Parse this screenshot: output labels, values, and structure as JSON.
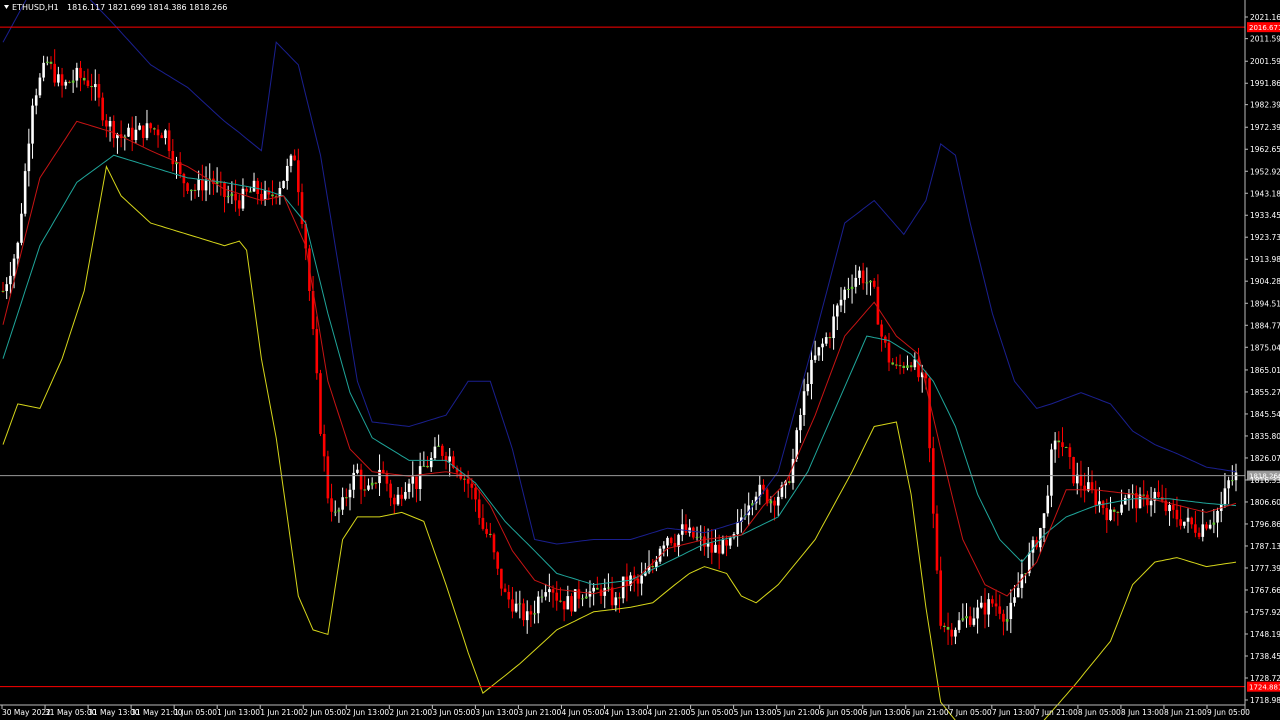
{
  "window": {
    "symbol_label": "ETHUSD,H1",
    "ohlc_label": "1816.117 1821.699 1814.386 1818.266"
  },
  "colors": {
    "background": "#000000",
    "bull_candle": "#ffffff",
    "bear_candle": "#ff0000",
    "doji_candle": "#66cc33",
    "bollinger_upper": "#1a1f8f",
    "bollinger_lower": "#d6d61a",
    "ma_fast": "#c81414",
    "ma_slow": "#1fa59a",
    "level_line": "#ff0000",
    "current_price_line": "#9a9a9a",
    "axis": "#bdbdbd"
  },
  "chart_data": {
    "type": "candlestick",
    "timeframe": "H1",
    "y_ticks": [
      "2021.166",
      "2011.595",
      "2001.595",
      "1991.860",
      "1982.390",
      "1972.390",
      "1962.655",
      "1952.920",
      "1943.185",
      "1933.455",
      "1923.735",
      "1913.988",
      "1904.285",
      "1894.510",
      "1884.775",
      "1875.040",
      "1865.010",
      "1855.275",
      "1845.540",
      "1835.805",
      "1826.070",
      "1816.335",
      "1806.600",
      "1796.865",
      "1787.130",
      "1777.395",
      "1767.660",
      "1757.925",
      "1748.190",
      "1738.455",
      "1728.720",
      "1718.985"
    ],
    "y_range": [
      1718.985,
      2021.166
    ],
    "x_ticks": [
      "30 May 2022",
      "31 May 05:00",
      "31 May 13:00",
      "31 May 21:00",
      "1 Jun 05:00",
      "1 Jun 13:00",
      "1 Jun 21:00",
      "2 Jun 05:00",
      "2 Jun 13:00",
      "2 Jun 21:00",
      "3 Jun 05:00",
      "3 Jun 13:00",
      "3 Jun 21:00",
      "4 Jun 05:00",
      "4 Jun 13:00",
      "4 Jun 21:00",
      "5 Jun 05:00",
      "5 Jun 13:00",
      "5 Jun 21:00",
      "6 Jun 05:00",
      "6 Jun 13:00",
      "6 Jun 21:00",
      "7 Jun 05:00",
      "7 Jun 13:00",
      "7 Jun 21:00",
      "8 Jun 05:00",
      "8 Jun 13:00",
      "8 Jun 21:00",
      "9 Jun 05:00"
    ],
    "price_markers": [
      {
        "label": "2016.671",
        "value": 2016.671,
        "color": "#ff0000"
      },
      {
        "label": "1818.266",
        "value": 1818.266,
        "color": "#9a9a9a"
      },
      {
        "label": "1724.881",
        "value": 1724.881,
        "color": "#ff0000"
      }
    ],
    "price_path": [
      [
        0,
        1900
      ],
      [
        4,
        1920
      ],
      [
        8,
        1985
      ],
      [
        12,
        2001
      ],
      [
        16,
        1990
      ],
      [
        20,
        1995
      ],
      [
        24,
        1992
      ],
      [
        28,
        1975
      ],
      [
        32,
        1968
      ],
      [
        36,
        1970
      ],
      [
        40,
        1972
      ],
      [
        44,
        1970
      ],
      [
        48,
        1950
      ],
      [
        52,
        1945
      ],
      [
        56,
        1950
      ],
      [
        60,
        1942
      ],
      [
        64,
        1940
      ],
      [
        68,
        1945
      ],
      [
        72,
        1940
      ],
      [
        76,
        1950
      ],
      [
        79,
        1960
      ],
      [
        82,
        1920
      ],
      [
        84,
        1880
      ],
      [
        86,
        1840
      ],
      [
        88,
        1810
      ],
      [
        90,
        1800
      ],
      [
        92,
        1805
      ],
      [
        94,
        1815
      ],
      [
        96,
        1820
      ],
      [
        98,
        1810
      ],
      [
        100,
        1812
      ],
      [
        102,
        1822
      ],
      [
        104,
        1815
      ],
      [
        106,
        1805
      ],
      [
        108,
        1812
      ],
      [
        110,
        1818
      ],
      [
        112,
        1815
      ],
      [
        114,
        1822
      ],
      [
        116,
        1825
      ],
      [
        118,
        1830
      ],
      [
        120,
        1828
      ],
      [
        122,
        1825
      ],
      [
        124,
        1820
      ],
      [
        126,
        1815
      ],
      [
        128,
        1808
      ],
      [
        130,
        1795
      ],
      [
        132,
        1790
      ],
      [
        134,
        1775
      ],
      [
        136,
        1765
      ],
      [
        138,
        1762
      ],
      [
        140,
        1758
      ],
      [
        142,
        1755
      ],
      [
        144,
        1760
      ],
      [
        146,
        1768
      ],
      [
        148,
        1772
      ],
      [
        150,
        1765
      ],
      [
        152,
        1762
      ],
      [
        154,
        1762
      ],
      [
        156,
        1766
      ],
      [
        158,
        1768
      ],
      [
        160,
        1765
      ],
      [
        162,
        1768
      ],
      [
        164,
        1765
      ],
      [
        166,
        1762
      ],
      [
        168,
        1770
      ],
      [
        170,
        1772
      ],
      [
        172,
        1770
      ],
      [
        174,
        1774
      ],
      [
        176,
        1778
      ],
      [
        178,
        1788
      ],
      [
        180,
        1792
      ],
      [
        182,
        1790
      ],
      [
        184,
        1794
      ],
      [
        186,
        1792
      ],
      [
        188,
        1790
      ],
      [
        190,
        1788
      ],
      [
        192,
        1785
      ],
      [
        194,
        1787
      ],
      [
        196,
        1785
      ],
      [
        198,
        1790
      ],
      [
        200,
        1800
      ],
      [
        202,
        1808
      ],
      [
        204,
        1812
      ],
      [
        206,
        1810
      ],
      [
        208,
        1808
      ],
      [
        210,
        1810
      ],
      [
        212,
        1812
      ],
      [
        214,
        1825
      ],
      [
        216,
        1845
      ],
      [
        218,
        1862
      ],
      [
        220,
        1870
      ],
      [
        222,
        1876
      ],
      [
        224,
        1882
      ],
      [
        226,
        1892
      ],
      [
        228,
        1900
      ],
      [
        230,
        1905
      ],
      [
        232,
        1908
      ],
      [
        234,
        1904
      ],
      [
        236,
        1898
      ],
      [
        238,
        1880
      ],
      [
        240,
        1870
      ],
      [
        242,
        1865
      ],
      [
        244,
        1868
      ],
      [
        246,
        1870
      ],
      [
        248,
        1862
      ],
      [
        250,
        1858
      ],
      [
        252,
        1800
      ],
      [
        254,
        1755
      ],
      [
        256,
        1750
      ],
      [
        258,
        1752
      ],
      [
        260,
        1754
      ],
      [
        262,
        1756
      ],
      [
        264,
        1758
      ],
      [
        266,
        1760
      ],
      [
        268,
        1762
      ],
      [
        270,
        1760
      ],
      [
        272,
        1755
      ],
      [
        274,
        1762
      ],
      [
        276,
        1775
      ],
      [
        278,
        1782
      ],
      [
        280,
        1790
      ],
      [
        282,
        1800
      ],
      [
        284,
        1826
      ],
      [
        286,
        1835
      ],
      [
        288,
        1828
      ],
      [
        290,
        1818
      ],
      [
        292,
        1815
      ],
      [
        294,
        1812
      ],
      [
        296,
        1808
      ],
      [
        298,
        1805
      ],
      [
        300,
        1800
      ],
      [
        302,
        1805
      ],
      [
        304,
        1810
      ],
      [
        306,
        1808
      ],
      [
        308,
        1806
      ],
      [
        310,
        1808
      ],
      [
        312,
        1810
      ],
      [
        314,
        1805
      ],
      [
        316,
        1802
      ],
      [
        318,
        1800
      ],
      [
        320,
        1798
      ],
      [
        322,
        1796
      ],
      [
        324,
        1795
      ],
      [
        326,
        1798
      ],
      [
        328,
        1800
      ],
      [
        330,
        1805
      ],
      [
        332,
        1815
      ],
      [
        334,
        1818
      ]
    ],
    "bollinger_upper": [
      [
        0,
        2010
      ],
      [
        10,
        2040
      ],
      [
        20,
        2035
      ],
      [
        30,
        2018
      ],
      [
        40,
        2000
      ],
      [
        50,
        1990
      ],
      [
        60,
        1975
      ],
      [
        64,
        1970
      ],
      [
        70,
        1962
      ],
      [
        74,
        2010
      ],
      [
        80,
        2000
      ],
      [
        86,
        1960
      ],
      [
        92,
        1900
      ],
      [
        96,
        1860
      ],
      [
        100,
        1842
      ],
      [
        110,
        1840
      ],
      [
        120,
        1845
      ],
      [
        126,
        1860
      ],
      [
        132,
        1860
      ],
      [
        138,
        1830
      ],
      [
        144,
        1790
      ],
      [
        150,
        1788
      ],
      [
        160,
        1790
      ],
      [
        170,
        1790
      ],
      [
        180,
        1795
      ],
      [
        190,
        1793
      ],
      [
        200,
        1798
      ],
      [
        210,
        1820
      ],
      [
        220,
        1880
      ],
      [
        228,
        1930
      ],
      [
        236,
        1940
      ],
      [
        244,
        1925
      ],
      [
        250,
        1940
      ],
      [
        254,
        1965
      ],
      [
        258,
        1960
      ],
      [
        262,
        1930
      ],
      [
        268,
        1890
      ],
      [
        274,
        1860
      ],
      [
        280,
        1848
      ],
      [
        284,
        1850
      ],
      [
        292,
        1855
      ],
      [
        300,
        1850
      ],
      [
        306,
        1838
      ],
      [
        312,
        1832
      ],
      [
        318,
        1828
      ],
      [
        326,
        1822
      ],
      [
        334,
        1820
      ]
    ],
    "bollinger_lower": [
      [
        0,
        1832
      ],
      [
        4,
        1850
      ],
      [
        10,
        1848
      ],
      [
        16,
        1870
      ],
      [
        22,
        1900
      ],
      [
        28,
        1955
      ],
      [
        32,
        1942
      ],
      [
        40,
        1930
      ],
      [
        50,
        1925
      ],
      [
        60,
        1920
      ],
      [
        64,
        1922
      ],
      [
        66,
        1918
      ],
      [
        70,
        1870
      ],
      [
        74,
        1835
      ],
      [
        80,
        1765
      ],
      [
        84,
        1750
      ],
      [
        88,
        1748
      ],
      [
        92,
        1790
      ],
      [
        96,
        1800
      ],
      [
        102,
        1800
      ],
      [
        108,
        1802
      ],
      [
        114,
        1798
      ],
      [
        120,
        1770
      ],
      [
        126,
        1740
      ],
      [
        130,
        1722
      ],
      [
        140,
        1735
      ],
      [
        150,
        1750
      ],
      [
        160,
        1758
      ],
      [
        170,
        1760
      ],
      [
        176,
        1762
      ],
      [
        182,
        1770
      ],
      [
        186,
        1775
      ],
      [
        190,
        1778
      ],
      [
        196,
        1775
      ],
      [
        200,
        1765
      ],
      [
        204,
        1762
      ],
      [
        210,
        1770
      ],
      [
        220,
        1790
      ],
      [
        230,
        1820
      ],
      [
        236,
        1840
      ],
      [
        242,
        1842
      ],
      [
        246,
        1810
      ],
      [
        250,
        1760
      ],
      [
        254,
        1718
      ],
      [
        258,
        1710
      ],
      [
        264,
        1705
      ],
      [
        272,
        1700
      ],
      [
        282,
        1710
      ],
      [
        290,
        1725
      ],
      [
        300,
        1745
      ],
      [
        306,
        1770
      ],
      [
        312,
        1780
      ],
      [
        318,
        1782
      ],
      [
        326,
        1778
      ],
      [
        334,
        1780
      ]
    ],
    "ma_fast": [
      [
        0,
        1885
      ],
      [
        10,
        1950
      ],
      [
        20,
        1975
      ],
      [
        30,
        1970
      ],
      [
        40,
        1962
      ],
      [
        50,
        1955
      ],
      [
        60,
        1945
      ],
      [
        70,
        1940
      ],
      [
        76,
        1942
      ],
      [
        82,
        1920
      ],
      [
        88,
        1860
      ],
      [
        94,
        1830
      ],
      [
        100,
        1820
      ],
      [
        110,
        1818
      ],
      [
        120,
        1820
      ],
      [
        126,
        1818
      ],
      [
        132,
        1805
      ],
      [
        138,
        1785
      ],
      [
        144,
        1772
      ],
      [
        150,
        1768
      ],
      [
        160,
        1766
      ],
      [
        170,
        1770
      ],
      [
        180,
        1786
      ],
      [
        190,
        1790
      ],
      [
        200,
        1792
      ],
      [
        206,
        1805
      ],
      [
        212,
        1815
      ],
      [
        220,
        1845
      ],
      [
        228,
        1880
      ],
      [
        236,
        1895
      ],
      [
        242,
        1880
      ],
      [
        248,
        1872
      ],
      [
        254,
        1830
      ],
      [
        260,
        1790
      ],
      [
        266,
        1770
      ],
      [
        272,
        1765
      ],
      [
        280,
        1780
      ],
      [
        288,
        1812
      ],
      [
        296,
        1812
      ],
      [
        306,
        1810
      ],
      [
        316,
        1806
      ],
      [
        326,
        1802
      ],
      [
        334,
        1806
      ]
    ],
    "ma_slow": [
      [
        0,
        1870
      ],
      [
        10,
        1920
      ],
      [
        20,
        1948
      ],
      [
        30,
        1960
      ],
      [
        40,
        1955
      ],
      [
        50,
        1950
      ],
      [
        60,
        1948
      ],
      [
        70,
        1945
      ],
      [
        76,
        1942
      ],
      [
        82,
        1930
      ],
      [
        88,
        1890
      ],
      [
        94,
        1855
      ],
      [
        100,
        1835
      ],
      [
        110,
        1825
      ],
      [
        120,
        1825
      ],
      [
        128,
        1815
      ],
      [
        136,
        1798
      ],
      [
        144,
        1785
      ],
      [
        150,
        1775
      ],
      [
        160,
        1770
      ],
      [
        170,
        1772
      ],
      [
        180,
        1780
      ],
      [
        190,
        1788
      ],
      [
        200,
        1792
      ],
      [
        210,
        1800
      ],
      [
        218,
        1820
      ],
      [
        226,
        1850
      ],
      [
        234,
        1880
      ],
      [
        240,
        1878
      ],
      [
        246,
        1872
      ],
      [
        252,
        1860
      ],
      [
        258,
        1840
      ],
      [
        264,
        1810
      ],
      [
        270,
        1790
      ],
      [
        276,
        1780
      ],
      [
        282,
        1792
      ],
      [
        288,
        1800
      ],
      [
        296,
        1805
      ],
      [
        306,
        1808
      ],
      [
        316,
        1808
      ],
      [
        326,
        1806
      ],
      [
        334,
        1805
      ]
    ]
  }
}
